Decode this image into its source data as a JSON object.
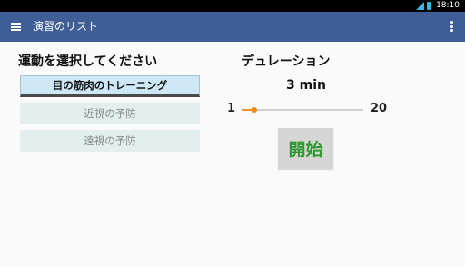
{
  "status_bar": {
    "time": "18:10",
    "colors": {
      "background": "#000000",
      "battery": "#33b5e5"
    }
  },
  "app_bar": {
    "title": "演習のリスト",
    "color": "#3f5e96"
  },
  "exercise_section": {
    "heading": "運動を選択してください",
    "options": [
      {
        "label": "目の筋肉のトレーニング",
        "selected": true
      },
      {
        "label": "近視の予防",
        "selected": false
      },
      {
        "label": "遠視の予防",
        "selected": false
      }
    ]
  },
  "duration_section": {
    "heading": "デュレーション",
    "value_text": "3 min",
    "slider": {
      "min_label": "1",
      "max_label": "20",
      "min": 1,
      "max": 20,
      "value": 3,
      "accent": "#f29226"
    }
  },
  "start_button": {
    "label": "開始",
    "color": "#2e9a2e"
  }
}
